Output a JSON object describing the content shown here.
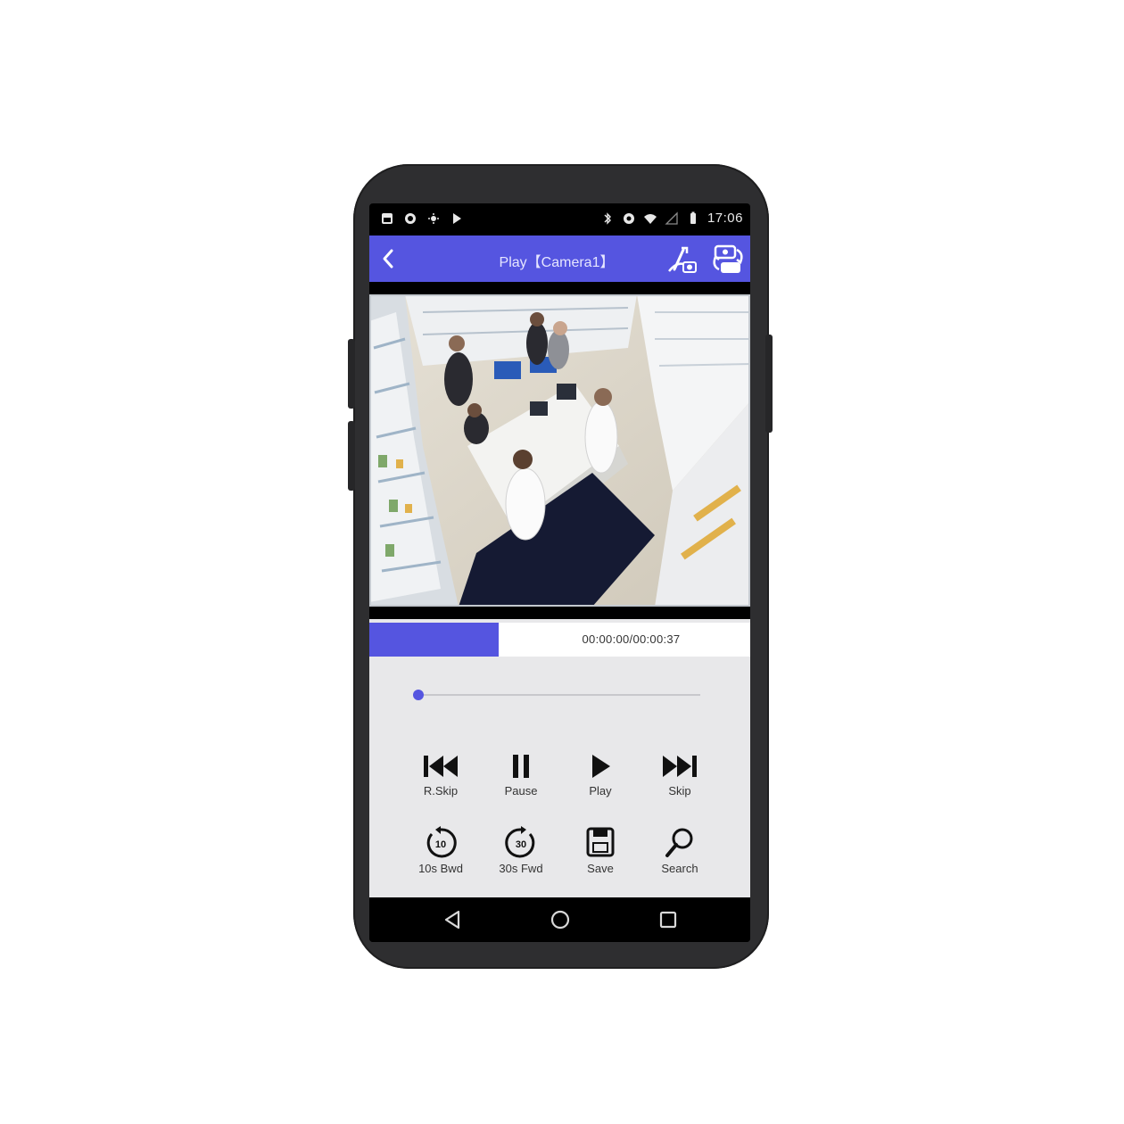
{
  "status_bar": {
    "time": "17:06",
    "left_icons": [
      "notification-icon",
      "circle-icon",
      "settings-icon",
      "play-store-icon"
    ],
    "right_icons": [
      "bluetooth-icon",
      "data-saver-icon",
      "wifi-icon",
      "signal-icon",
      "battery-icon"
    ]
  },
  "app_bar": {
    "title": "Play【Camera1】",
    "back_icon": "chevron-left-icon",
    "action_icons": [
      "snapshot-icon",
      "switch-camera-icon"
    ]
  },
  "playback": {
    "time_text": "00:00:00/00:00:37",
    "progress_fraction": 0.34,
    "slider_fraction": 0.0
  },
  "controls": {
    "row1": [
      {
        "icon": "skip-back-icon",
        "label": "R.Skip"
      },
      {
        "icon": "pause-icon",
        "label": "Pause"
      },
      {
        "icon": "play-icon",
        "label": "Play"
      },
      {
        "icon": "skip-forward-icon",
        "label": "Skip"
      }
    ],
    "row2": [
      {
        "icon": "rewind-10-icon",
        "label": "10s Bwd",
        "badge": "10"
      },
      {
        "icon": "forward-30-icon",
        "label": "30s Fwd",
        "badge": "30"
      },
      {
        "icon": "save-icon",
        "label": "Save"
      },
      {
        "icon": "search-icon",
        "label": "Search"
      }
    ]
  },
  "nav_bar": [
    "back-triangle-icon",
    "home-circle-icon",
    "recents-square-icon"
  ],
  "colors": {
    "accent": "#5555e0",
    "panel": "#e8e8ea",
    "phone_body": "#2e2e30"
  }
}
